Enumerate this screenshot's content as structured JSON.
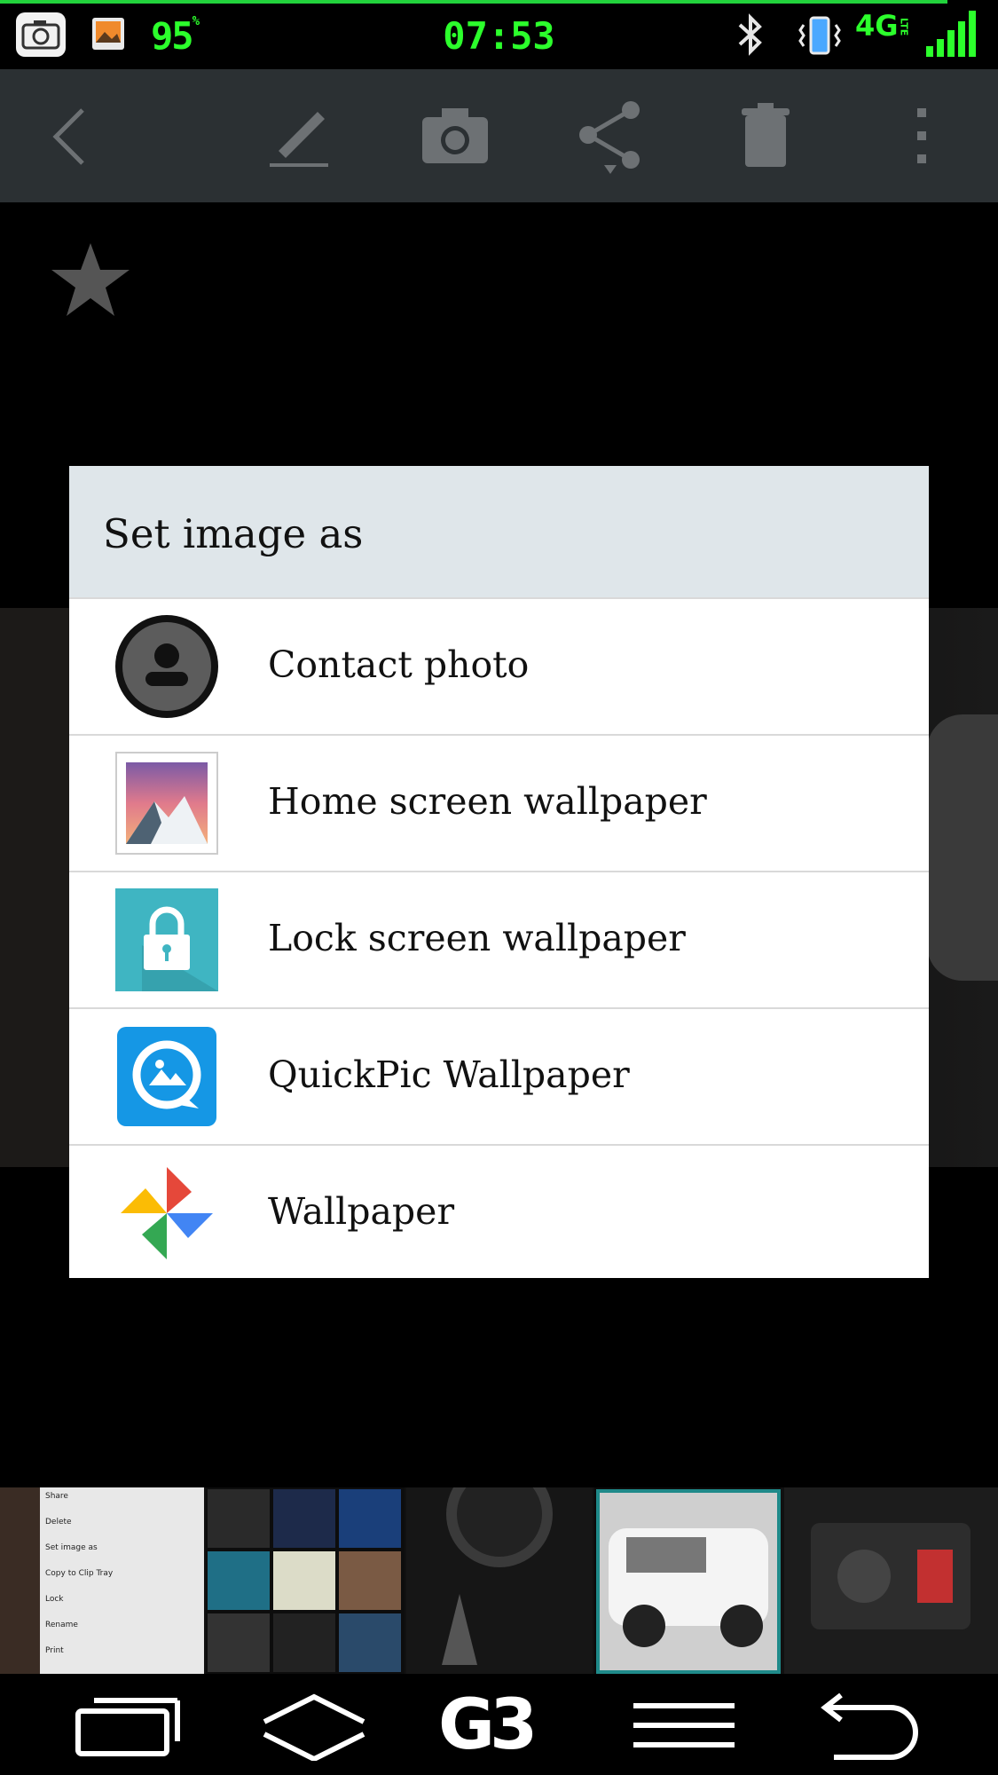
{
  "status_bar": {
    "battery": "95",
    "battery_unit": "%",
    "clock": "07:53",
    "network": "4G",
    "network_sub": "LTE",
    "accent_color": "#2cff2c"
  },
  "toolbar": {
    "icons": [
      "back-icon",
      "edit-icon",
      "camera-icon",
      "share-icon",
      "delete-icon",
      "overflow-menu-icon"
    ]
  },
  "dialog": {
    "title": "Set image as",
    "items": [
      {
        "label": "Contact photo",
        "icon": "contact-icon"
      },
      {
        "label": "Home screen wallpaper",
        "icon": "home-wallpaper-icon"
      },
      {
        "label": "Lock screen wallpaper",
        "icon": "lock-icon"
      },
      {
        "label": "QuickPic Wallpaper",
        "icon": "quickpic-icon"
      },
      {
        "label": "Wallpaper",
        "icon": "photos-pinwheel-icon"
      }
    ]
  },
  "thumbnail_menu": [
    "Share",
    "Delete",
    "Set image as",
    "Copy to Clip Tray",
    "Lock",
    "Rename",
    "Print"
  ],
  "navbar": {
    "logo": "G3",
    "buttons": [
      "recent-apps-icon",
      "home-icon",
      "g3-logo",
      "menu-icon",
      "back-icon"
    ]
  }
}
